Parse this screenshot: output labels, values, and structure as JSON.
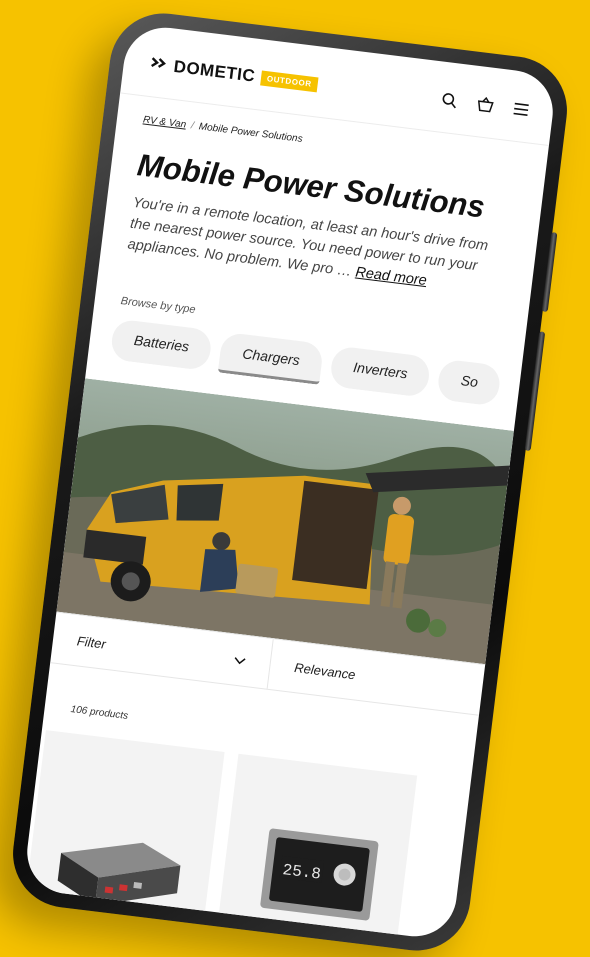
{
  "brand": {
    "name": "DOMETIC",
    "badge": "OUTDOOR",
    "accent": "#f6c200"
  },
  "header": {
    "icons": [
      "search-icon",
      "basket-icon",
      "menu-icon"
    ]
  },
  "breadcrumb": {
    "parent": "RV & Van",
    "current": "Mobile Power Solutions"
  },
  "page": {
    "title": "Mobile Power Solutions",
    "description": "You're in a remote location, at least an hour's drive from the nearest power source. You need power to run your appliances. No problem. We pro …",
    "read_more": "Read more"
  },
  "browse": {
    "label": "Browse by type",
    "chips": [
      "Batteries",
      "Chargers",
      "Inverters",
      "So"
    ]
  },
  "controls": {
    "filter": "Filter",
    "sort": "Relevance"
  },
  "results": {
    "count": "106 products"
  },
  "products": [
    {
      "name": "power-inverter"
    },
    {
      "name": "control-panel",
      "display": "25.8"
    }
  ]
}
